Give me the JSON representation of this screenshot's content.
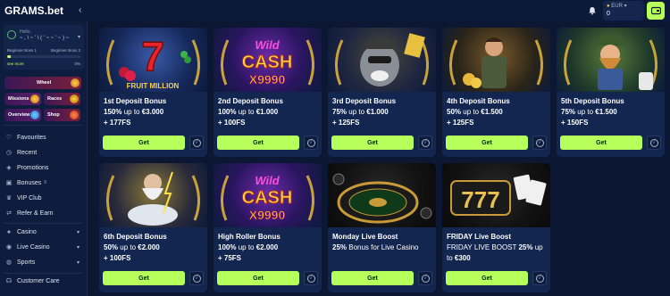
{
  "header": {
    "logo": "GRAMS.bet",
    "wallet_currency": "EUR",
    "wallet_amount": "0"
  },
  "profile": {
    "hello": "Hello,",
    "username": "~ , \\ ~ ' \\ ( ' ~ ~ ' ~ ) ~",
    "level_current": "Beginner Boss 1",
    "level_next": "Beginner Boss 2",
    "see_more": "see more",
    "progress_label": "0%",
    "progress": 0.05
  },
  "promos": {
    "wheel": "Wheel",
    "missions": "Missions",
    "races": "Races",
    "overview": "Overview",
    "shop": "Shop"
  },
  "nav": {
    "favourites": "Favourites",
    "recent": "Recent",
    "promotions": "Promotions",
    "bonuses": "Bonuses",
    "bonuses_badge": "8",
    "vip": "VIP Club",
    "refer": "Refer & Earn",
    "casino": "Casino",
    "live_casino": "Live Casino",
    "sports": "Sports",
    "support": "Customer Care"
  },
  "cards": [
    {
      "title": "1st Deposit Bonus",
      "line1_b": "150%",
      "line1": " up to ",
      "line1_amt": "€3.000",
      "line2": "+ 177FS",
      "button": "Get",
      "art_label": "FRUIT MILLION"
    },
    {
      "title": "2nd Deposit Bonus",
      "line1_b": "100%",
      "line1": " up to ",
      "line1_amt": "€1.000",
      "line2": "+ 100FS",
      "button": "Get",
      "art_label": "WILD CASH X9990"
    },
    {
      "title": "3rd Deposit Bonus",
      "line1_b": "75%",
      "line1": " up to ",
      "line1_amt": "€1.000",
      "line2": "+ 125FS",
      "button": "Get",
      "art_label": ""
    },
    {
      "title": "4th Deposit Bonus",
      "line1_b": "50%",
      "line1": " up to ",
      "line1_amt": "€1.500",
      "line2": "+ 125FS",
      "button": "Get",
      "art_label": ""
    },
    {
      "title": "5th Deposit Bonus",
      "line1_b": "75%",
      "line1": " up to ",
      "line1_amt": "€1.500",
      "line2": "+ 150FS",
      "button": "Get",
      "art_label": ""
    },
    {
      "title": "6th Deposit Bonus",
      "line1_b": "50%",
      "line1": " up to ",
      "line1_amt": "€2.000",
      "line2": "+ 100FS",
      "button": "Get",
      "art_label": ""
    },
    {
      "title": "High Roller Bonus",
      "line1_b": "100%",
      "line1": " up to ",
      "line1_amt": "€2.000",
      "line2": "+ 75FS",
      "button": "Get",
      "art_label": "WILD CASH X9990"
    },
    {
      "title": "Monday Live Boost",
      "line1_b": "25%",
      "line1": " Bonus for Live Casino",
      "line1_amt": "",
      "line2": "",
      "button": "Get",
      "art_label": ""
    },
    {
      "title": "FRIDAY Live Boost",
      "line1_b": "",
      "line1": "FRIDAY LIVE BOOST ",
      "line1_amt": "25%",
      "line1_tail": " up",
      "line2a": "to ",
      "line2": "€300",
      "button": "Get",
      "art_label": "777"
    }
  ]
}
